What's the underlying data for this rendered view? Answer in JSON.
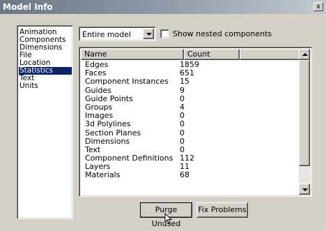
{
  "window": {
    "title": "Model Info",
    "close_glyph": "x"
  },
  "sidebar": {
    "items": [
      {
        "label": "Animation",
        "selected": false
      },
      {
        "label": "Components",
        "selected": false
      },
      {
        "label": "Dimensions",
        "selected": false
      },
      {
        "label": "File",
        "selected": false
      },
      {
        "label": "Location",
        "selected": false
      },
      {
        "label": "Statistics",
        "selected": true
      },
      {
        "label": "Text",
        "selected": false
      },
      {
        "label": "Units",
        "selected": false
      }
    ]
  },
  "scope_dropdown": {
    "value": "Entire model"
  },
  "nested_checkbox": {
    "label": "Show nested components",
    "checked": false
  },
  "table": {
    "columns": [
      "Name",
      "Count"
    ],
    "rows": [
      {
        "name": "Edges",
        "count": "1859"
      },
      {
        "name": "Faces",
        "count": "651"
      },
      {
        "name": "Component Instances",
        "count": "15"
      },
      {
        "name": "Guides",
        "count": "9"
      },
      {
        "name": "Guide Points",
        "count": "0"
      },
      {
        "name": "Groups",
        "count": "4"
      },
      {
        "name": "Images",
        "count": "0"
      },
      {
        "name": "3d Polylines",
        "count": "0"
      },
      {
        "name": "Section Planes",
        "count": "0"
      },
      {
        "name": "Dimensions",
        "count": "0"
      },
      {
        "name": "Text",
        "count": "0"
      },
      {
        "name": "Component Definitions",
        "count": "112"
      },
      {
        "name": "Layers",
        "count": "11"
      },
      {
        "name": "Materials",
        "count": "68"
      }
    ]
  },
  "buttons": {
    "purge": "Purge Unused",
    "fix": "Fix Problems"
  }
}
